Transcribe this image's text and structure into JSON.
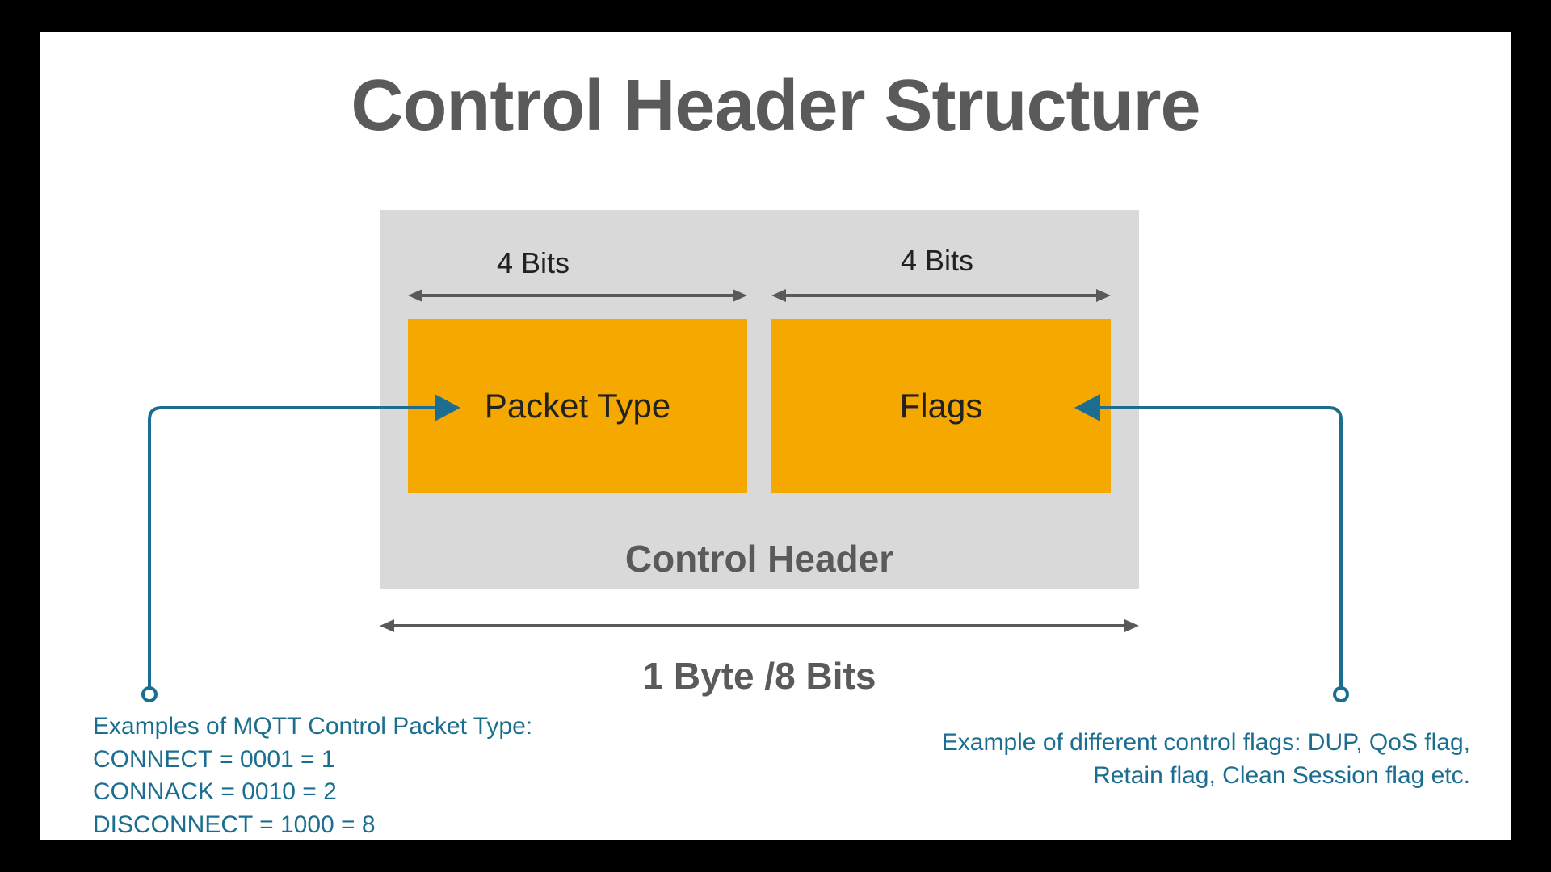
{
  "title": "Control Header Structure",
  "bits_left": "4 Bits",
  "bits_right": "4 Bits",
  "packet_type": "Packet Type",
  "flags": "Flags",
  "control_header": "Control Header",
  "byte_label": "1 Byte /8 Bits",
  "callout_left": {
    "line1": "Examples of MQTT Control Packet Type:",
    "line2": "CONNECT = 0001 = 1",
    "line3": "CONNACK = 0010 = 2",
    "line4": "DISCONNECT = 1000 = 8"
  },
  "callout_right": "Example of different control flags: DUP, QoS flag,  Retain flag, Clean Session flag etc.",
  "colors": {
    "accent": "#1b6e8f",
    "field": "#f5a800",
    "box": "#d9d9d9",
    "arrow": "#595959"
  }
}
